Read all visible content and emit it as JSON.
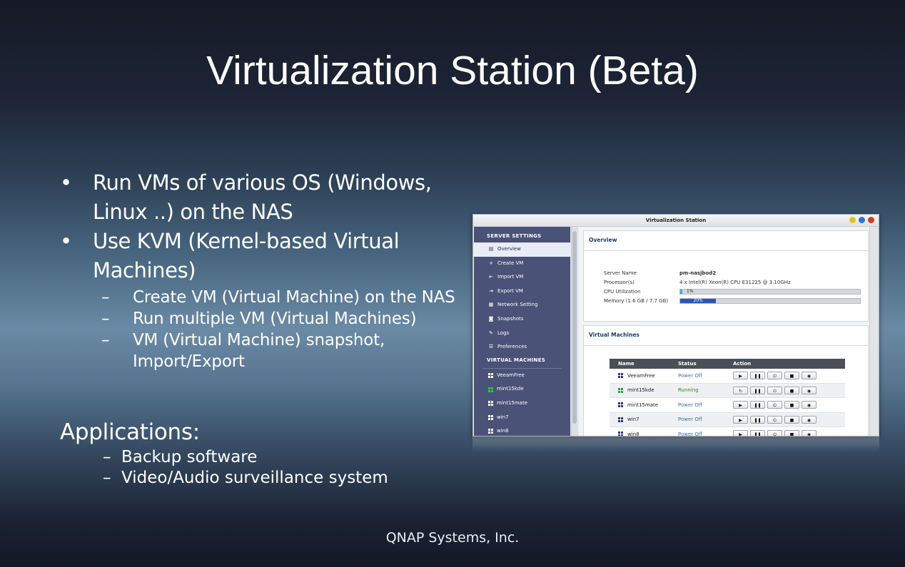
{
  "slide": {
    "title": "Virtualization Station (Beta)",
    "bullets": [
      {
        "text": "Run VMs of various OS (Windows, Linux ..) on the NAS"
      },
      {
        "text": "Use KVM (Kernel-based Virtual Machines)",
        "sub": [
          "Create VM (Virtual Machine) on the NAS",
          "Run multiple VM (Virtual Machines)",
          "VM (Virtual Machine) snapshot, Import/Export"
        ]
      }
    ],
    "applications": {
      "title": "Applications:",
      "items": [
        "Backup software",
        "Video/Audio surveillance system"
      ]
    },
    "footer": "QNAP Systems, Inc.",
    "bullet_glyph": "•",
    "dash_glyph": "–"
  },
  "window": {
    "title": "Virtualization Station",
    "buttons": [
      {
        "name": "minimize-icon",
        "color": "#e8c21a"
      },
      {
        "name": "restore-icon",
        "color": "#2f74d0"
      },
      {
        "name": "close-icon",
        "color": "#d23a2a"
      }
    ]
  },
  "sidebar": {
    "server_heading": "SERVER SETTINGS",
    "items": [
      {
        "label": "Overview",
        "icon": "overview-icon",
        "glyph": "▤"
      },
      {
        "label": "Create VM",
        "icon": "plus-icon",
        "glyph": "+"
      },
      {
        "label": "Import VM",
        "icon": "import-icon",
        "glyph": "⇤"
      },
      {
        "label": "Export VM",
        "icon": "export-icon",
        "glyph": "⇥"
      },
      {
        "label": "Network Setting",
        "icon": "network-icon",
        "glyph": "▦"
      },
      {
        "label": "Snapshots",
        "icon": "camera-icon",
        "glyph": "◙"
      },
      {
        "label": "Logs",
        "icon": "logs-icon",
        "glyph": "✎"
      },
      {
        "label": "Preferences",
        "icon": "preferences-icon",
        "glyph": "☰"
      }
    ],
    "vm_heading": "VIRTUAL MACHINES",
    "vms": [
      {
        "label": "VeeamFree",
        "running": false
      },
      {
        "label": "mint15kde",
        "running": true
      },
      {
        "label": "mint15mate",
        "running": false
      },
      {
        "label": "win7",
        "running": false
      },
      {
        "label": "win8",
        "running": false
      }
    ]
  },
  "overview": {
    "title": "Overview",
    "server_name_label": "Server Name",
    "server_name": "pm-nasjbod2",
    "processor_label": "Processor(s)",
    "processor": "4 x Intel(R) Xeon(R) CPU E31225 @ 3.10GHz",
    "cpu_label": "CPU Utilization",
    "cpu_text": "1%",
    "cpu_fraction": 0.01,
    "memory_label": "Memory (1.6 GB / 7.7 GB)",
    "memory_text": "20%",
    "memory_fraction": 0.2
  },
  "vm_panel": {
    "title": "Virtual Machines",
    "columns": {
      "name": "Name",
      "status": "Status",
      "action": "Action"
    },
    "rows": [
      {
        "name": "VeeamFree",
        "status": "Power Off",
        "running": false
      },
      {
        "name": "mint15kde",
        "status": "Running",
        "running": true
      },
      {
        "name": "mint15mate",
        "status": "Power Off",
        "running": false
      },
      {
        "name": "win7",
        "status": "Power Off",
        "running": false
      },
      {
        "name": "win8",
        "status": "Power Off",
        "running": false
      }
    ],
    "action_glyphs_off": [
      "▶",
      "❚❚",
      "⏻",
      "■",
      "◉"
    ],
    "action_glyphs_on": [
      "↻",
      "❚❚",
      "⏻",
      "■",
      "◉"
    ],
    "action_names": [
      "start-icon",
      "pause-icon",
      "power-icon",
      "stop-icon",
      "console-icon"
    ]
  }
}
